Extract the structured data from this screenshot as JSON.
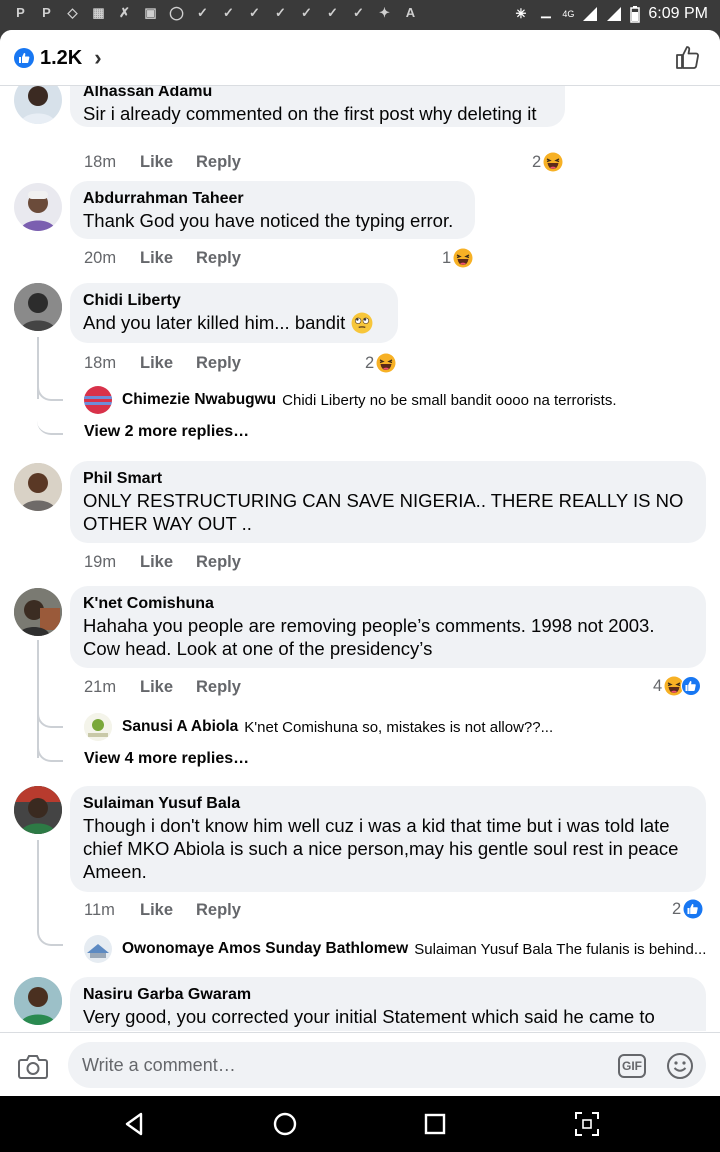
{
  "status_bar": {
    "time": "6:09 PM",
    "network": "4G",
    "left_icons": [
      "p-icon",
      "p-icon",
      "messenger-icon",
      "gallery-icon",
      "tools-icon",
      "chat-icon",
      "instagram-icon",
      "check-icon",
      "check-icon",
      "check-icon",
      "check-icon",
      "check-icon",
      "check-icon",
      "check-icon",
      "twitter-icon",
      "a-icon"
    ]
  },
  "header": {
    "reaction_count": "1.2K"
  },
  "comments": [
    {
      "author": "Alhassan Adamu",
      "text": "Sir i already commented on the first post why deleting it",
      "time": "18m",
      "like": "Like",
      "reply": "Reply",
      "reaction_count": "2",
      "reactions": [
        "haha"
      ]
    },
    {
      "author": "Abdurrahman Taheer",
      "text": "Thank God you have noticed the typing error.",
      "time": "20m",
      "like": "Like",
      "reply": "Reply",
      "reaction_count": "1",
      "reactions": [
        "haha"
      ]
    },
    {
      "author": "Chidi Liberty",
      "text": "And you later killed him... bandit",
      "time": "18m",
      "like": "Like",
      "reply": "Reply",
      "reaction_count": "2",
      "reactions": [
        "haha"
      ],
      "reply_preview": {
        "author": "Chimezie Nwabugwu",
        "text": "Chidi Liberty no be small bandit oooo na terrorists."
      },
      "more_replies": "View 2 more replies…"
    },
    {
      "author": "Phil Smart",
      "text_lines": [
        "ONLY RESTRUCTURING CAN SAVE NIGERIA.. THERE REALLY IS NO",
        "OTHER WAY OUT .."
      ],
      "time": "19m",
      "like": "Like",
      "reply": "Reply"
    },
    {
      "author": "K'net Comishuna",
      "text_lines": [
        "Hahaha you people are removing people’s comments. 1998 not 2003.",
        "Cow head. Look at one of the presidency’s"
      ],
      "time": "21m",
      "like": "Like",
      "reply": "Reply",
      "reaction_count": "4",
      "reactions": [
        "haha",
        "like"
      ],
      "reply_preview": {
        "author": "Sanusi A Abiola",
        "text": "K'net Comishuna so, mistakes is not allow??..."
      },
      "more_replies": "View 4 more replies…"
    },
    {
      "author": "Sulaiman Yusuf Bala",
      "text_lines": [
        "Though i don't know him well cuz i was a kid that time but i was told late",
        "chief MKO Abiola is such a nice person,may his gentle soul rest in peace",
        "Ameen."
      ],
      "time": "11m",
      "like": "Like",
      "reply": "Reply",
      "reaction_count": "2",
      "reactions": [
        "like"
      ],
      "reply_preview": {
        "author": "Owonomaye Amos Sunday Bathlomew",
        "text": "Sulaiman Yusuf Bala The fulanis is behind..."
      }
    },
    {
      "author": "Nasiru Garba Gwaram",
      "text": "Very good, you corrected your initial Statement which said he came to"
    }
  ],
  "composer": {
    "placeholder": "Write a comment…",
    "gif_label": "GIF"
  },
  "colors": {
    "accent": "#1877f2",
    "bubble": "#f0f2f5",
    "meta_text": "#65676b",
    "haha": "#f7b125"
  }
}
